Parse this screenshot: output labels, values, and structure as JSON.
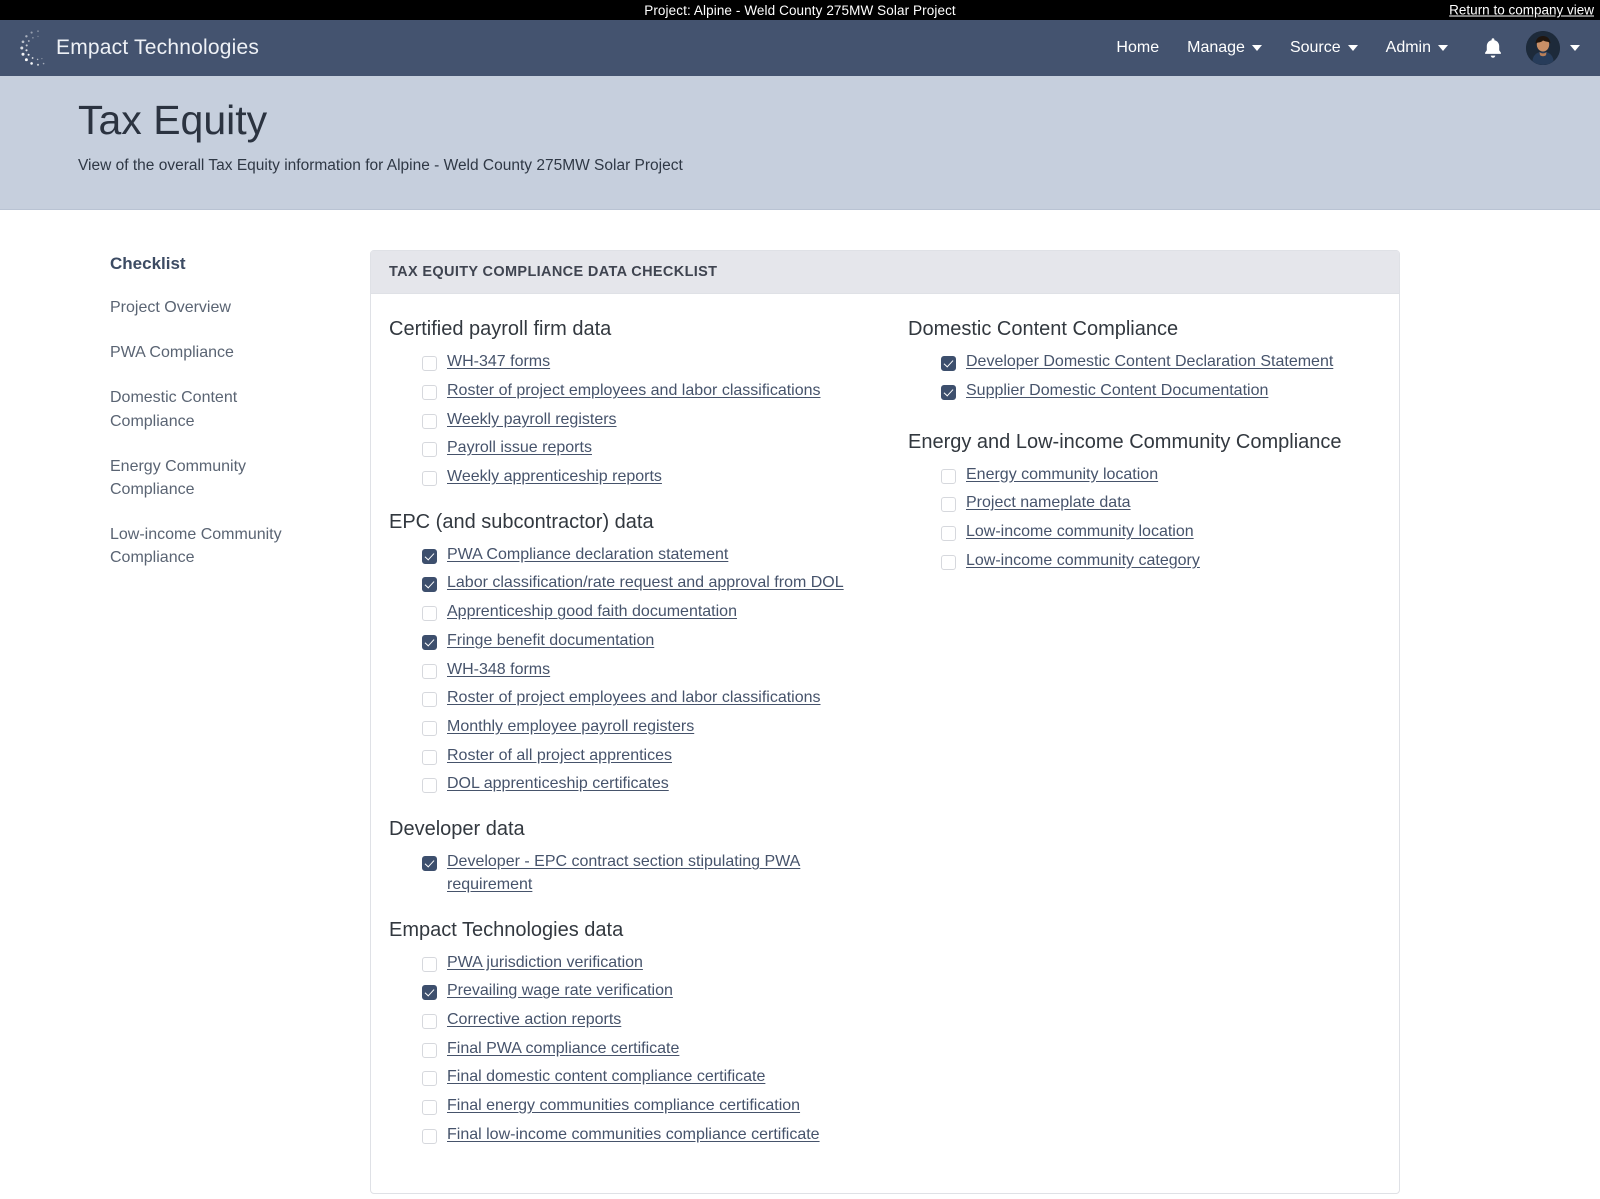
{
  "topbar": {
    "project_label": "Project: Alpine - Weld County 275MW Solar Project",
    "return_link": "Return to company view"
  },
  "navbar": {
    "brand": "Empact Technologies",
    "items": [
      {
        "label": "Home",
        "has_caret": false
      },
      {
        "label": "Manage",
        "has_caret": true
      },
      {
        "label": "Source",
        "has_caret": true
      },
      {
        "label": "Admin",
        "has_caret": true
      }
    ],
    "notification_icon": "bell-icon",
    "avatar_icon": "user-avatar",
    "colors": {
      "navbar_bg": "#44536f",
      "topbar_bg": "#000000"
    }
  },
  "page": {
    "title": "Tax Equity",
    "subtitle": "View of the overall Tax Equity information for Alpine - Weld County 275MW Solar Project",
    "header_bg": "#c6cfdd"
  },
  "sidebar": {
    "title": "Checklist",
    "items": [
      {
        "label": "Project Overview"
      },
      {
        "label": "PWA Compliance"
      },
      {
        "label": "Domestic Content Compliance"
      },
      {
        "label": "Energy Community Compliance"
      },
      {
        "label": "Low-income Community Compliance"
      }
    ]
  },
  "card": {
    "header": "TAX EQUITY COMPLIANCE DATA CHECKLIST",
    "header_bg": "#e5e6eb",
    "checked_color": "#3d4f6d",
    "left_groups": [
      {
        "title": "Certified payroll firm data",
        "items": [
          {
            "label": "WH-347 forms",
            "checked": false
          },
          {
            "label": "Roster of project employees and labor classifications",
            "checked": false
          },
          {
            "label": "Weekly payroll registers",
            "checked": false
          },
          {
            "label": "Payroll issue reports",
            "checked": false
          },
          {
            "label": "Weekly apprenticeship reports",
            "checked": false
          }
        ]
      },
      {
        "title": "EPC (and subcontractor) data",
        "items": [
          {
            "label": "PWA Compliance declaration statement",
            "checked": true
          },
          {
            "label": "Labor classification/rate request and approval from DOL",
            "checked": true
          },
          {
            "label": "Apprenticeship good faith documentation",
            "checked": false
          },
          {
            "label": "Fringe benefit documentation",
            "checked": true
          },
          {
            "label": "WH-348 forms",
            "checked": false
          },
          {
            "label": "Roster of project employees and labor classifications",
            "checked": false
          },
          {
            "label": "Monthly employee payroll registers",
            "checked": false
          },
          {
            "label": "Roster of all project apprentices",
            "checked": false
          },
          {
            "label": "DOL apprenticeship certificates",
            "checked": false
          }
        ]
      },
      {
        "title": "Developer data",
        "items": [
          {
            "label": "Developer - EPC contract section stipulating PWA requirement",
            "checked": true
          }
        ]
      },
      {
        "title": "Empact Technologies data",
        "items": [
          {
            "label": "PWA jurisdiction verification",
            "checked": false
          },
          {
            "label": "Prevailing wage rate verification",
            "checked": true
          },
          {
            "label": "Corrective action reports",
            "checked": false
          },
          {
            "label": "Final PWA compliance certificate",
            "checked": false
          },
          {
            "label": "Final domestic content compliance certificate",
            "checked": false
          },
          {
            "label": "Final energy communities compliance certification",
            "checked": false
          },
          {
            "label": "Final low-income communities compliance certificate",
            "checked": false
          }
        ]
      }
    ],
    "right_groups": [
      {
        "title": "Domestic Content Compliance",
        "items": [
          {
            "label": "Developer Domestic Content Declaration Statement",
            "checked": true
          },
          {
            "label": "Supplier Domestic Content Documentation",
            "checked": true
          }
        ]
      },
      {
        "title": "Energy and Low-income Community Compliance",
        "items": [
          {
            "label": "Energy community location",
            "checked": false
          },
          {
            "label": "Project nameplate data",
            "checked": false
          },
          {
            "label": "Low-income community location",
            "checked": false
          },
          {
            "label": "Low-income community category",
            "checked": false
          }
        ]
      }
    ]
  }
}
